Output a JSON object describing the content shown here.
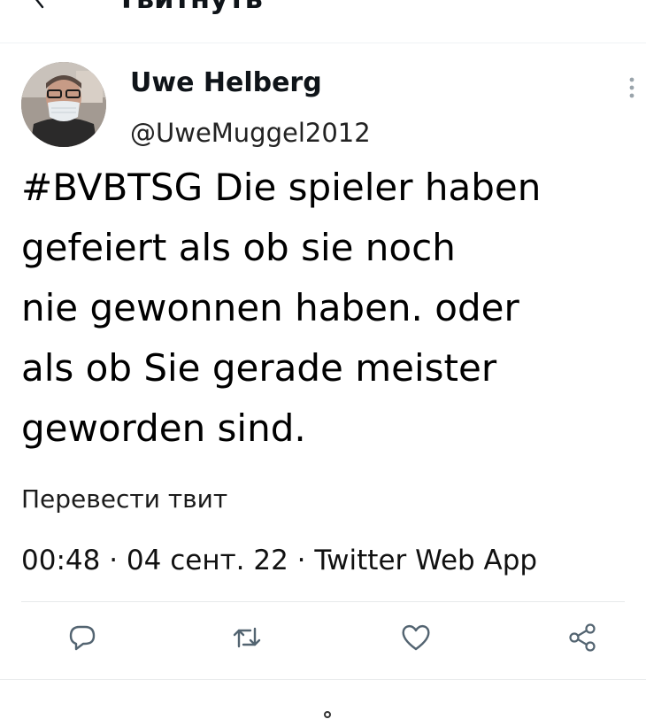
{
  "header": {
    "title": "Твитнуть"
  },
  "tweet": {
    "author_name": "Uwe Helberg",
    "author_handle": "@UweMuggel2012",
    "text": "#BVBTSG Die spieler haben\ngefeiert als ob sie noch\nnie gewonnen haben. oder\nals ob Sie gerade meister\ngeworden sind.",
    "translate_label": "Перевести твит",
    "meta": "00:48 · 04 сент. 22 · Twitter Web App"
  },
  "actions": [
    {
      "icon": "reply-icon"
    },
    {
      "icon": "retweet-icon"
    },
    {
      "icon": "like-icon"
    },
    {
      "icon": "share-icon"
    }
  ],
  "colors": {
    "text": "#0f1419",
    "divider": "#e6e9ea",
    "icon": "#536471"
  }
}
